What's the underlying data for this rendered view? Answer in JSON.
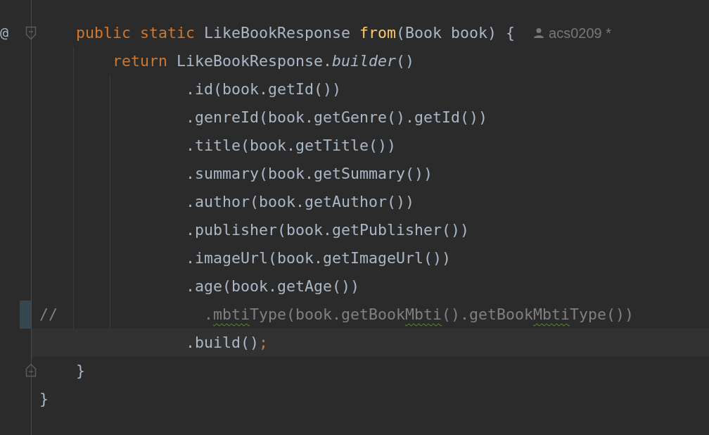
{
  "lines": [
    {
      "gutter": "@",
      "kind": "fold_start",
      "current": false,
      "changed": false,
      "hint": "acs0209 *",
      "tokens": [
        {
          "kind": "keyword",
          "text": "    public static "
        },
        {
          "kind": "plain",
          "text": "LikeBookResponse "
        },
        {
          "kind": "method",
          "text": "from"
        },
        {
          "kind": "plain",
          "text": "(Book book) {"
        }
      ]
    },
    {
      "current": false,
      "changed": false,
      "tokens": [
        {
          "kind": "keyword",
          "text": "        return "
        },
        {
          "kind": "plain",
          "text": "LikeBookResponse."
        },
        {
          "kind": "italic",
          "text": "builder"
        },
        {
          "kind": "plain",
          "text": "()"
        }
      ]
    },
    {
      "current": false,
      "changed": false,
      "tokens": [
        {
          "kind": "plain",
          "text": "                .id(book.getId())"
        }
      ]
    },
    {
      "current": false,
      "changed": false,
      "tokens": [
        {
          "kind": "plain",
          "text": "                .genreId(book.getGenre().getId())"
        }
      ]
    },
    {
      "current": false,
      "changed": false,
      "tokens": [
        {
          "kind": "plain",
          "text": "                .title(book.getTitle())"
        }
      ]
    },
    {
      "current": false,
      "changed": false,
      "tokens": [
        {
          "kind": "plain",
          "text": "                .summary(book.getSummary())"
        }
      ]
    },
    {
      "current": false,
      "changed": false,
      "tokens": [
        {
          "kind": "plain",
          "text": "                .author(book.getAuthor())"
        }
      ]
    },
    {
      "current": false,
      "changed": false,
      "tokens": [
        {
          "kind": "plain",
          "text": "                .publisher(book.getPublisher())"
        }
      ]
    },
    {
      "current": false,
      "changed": false,
      "tokens": [
        {
          "kind": "plain",
          "text": "                .imageUrl(book.getImageUrl())"
        }
      ]
    },
    {
      "current": false,
      "changed": false,
      "tokens": [
        {
          "kind": "plain",
          "text": "                .age(book.getAge())"
        }
      ]
    },
    {
      "current": false,
      "changed": true,
      "tokens": [
        {
          "kind": "comment",
          "text": "//                ."
        },
        {
          "kind": "warning",
          "text": "mbti"
        },
        {
          "kind": "comment",
          "text": "Type(book.getBook"
        },
        {
          "kind": "warning",
          "text": "Mbti"
        },
        {
          "kind": "comment",
          "text": "().getBook"
        },
        {
          "kind": "warning",
          "text": "Mbti"
        },
        {
          "kind": "comment",
          "text": "Type())"
        }
      ]
    },
    {
      "current": true,
      "changed": false,
      "tokens": [
        {
          "kind": "plain",
          "text": "                .build()"
        },
        {
          "kind": "keyword",
          "text": ";"
        }
      ]
    },
    {
      "kind": "fold_end",
      "current": false,
      "changed": false,
      "tokens": [
        {
          "kind": "plain",
          "text": "    }"
        }
      ]
    },
    {
      "current": false,
      "changed": false,
      "tokens": [
        {
          "kind": "plain",
          "text": "}"
        }
      ]
    }
  ]
}
